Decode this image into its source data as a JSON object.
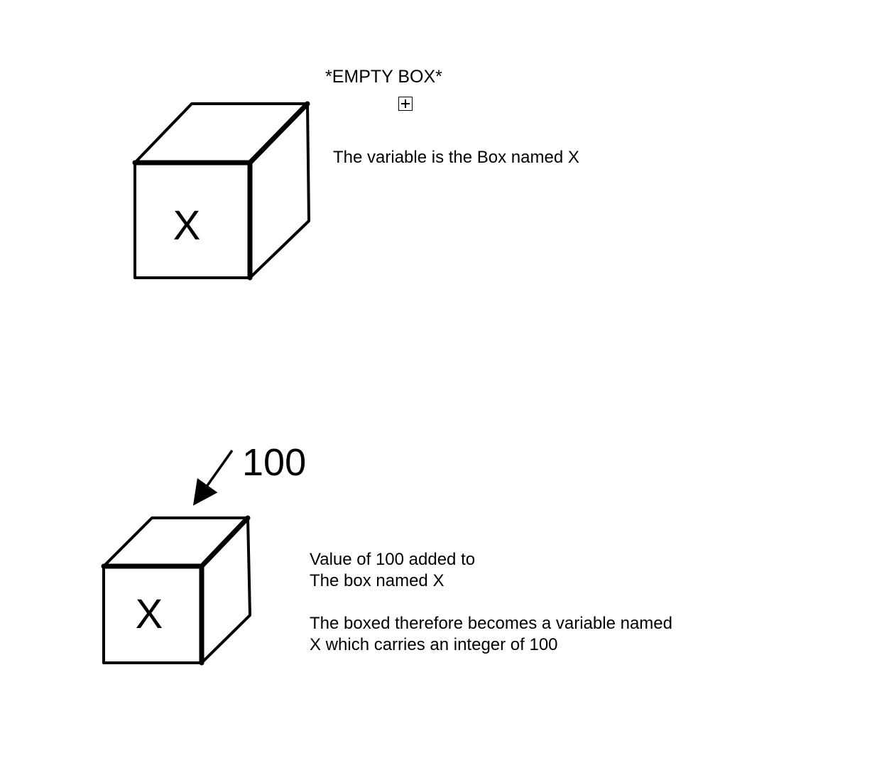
{
  "diagram": {
    "top": {
      "box_letter": "X",
      "title": "*EMPTY BOX*",
      "caption": "The variable is the Box named X"
    },
    "bottom": {
      "box_letter": "X",
      "value": "100",
      "caption_lines": [
        "Value of 100 added to",
        "The box named X",
        "The boxed therefore becomes a variable named",
        "X which carries an integer of 100"
      ]
    }
  }
}
